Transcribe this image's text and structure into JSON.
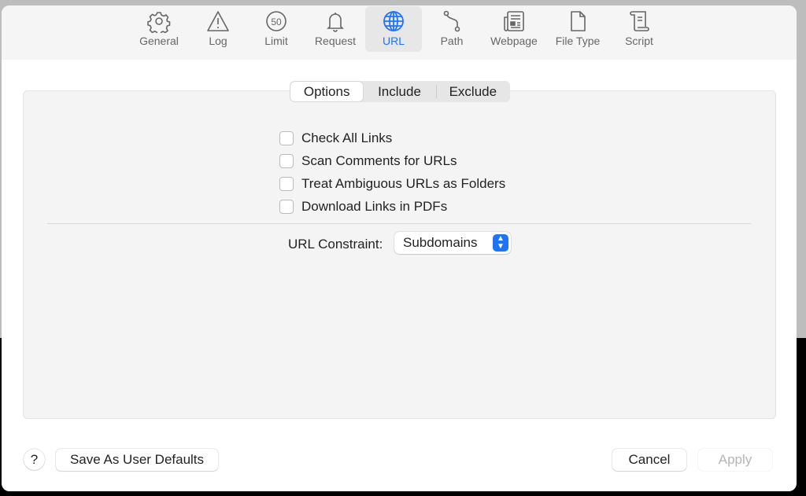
{
  "toolbar": {
    "items": [
      {
        "label": "General",
        "icon": "gear-icon"
      },
      {
        "label": "Log",
        "icon": "warning-icon"
      },
      {
        "label": "Limit",
        "icon": "limit-50-icon",
        "badge": "50"
      },
      {
        "label": "Request",
        "icon": "bell-icon"
      },
      {
        "label": "URL",
        "icon": "globe-icon",
        "active": true
      },
      {
        "label": "Path",
        "icon": "path-icon"
      },
      {
        "label": "Webpage",
        "icon": "newspaper-icon"
      },
      {
        "label": "File Type",
        "icon": "file-icon"
      },
      {
        "label": "Script",
        "icon": "scroll-icon"
      }
    ],
    "accent": "#1f74f5"
  },
  "tabs": {
    "options": "Options",
    "include": "Include",
    "exclude": "Exclude",
    "selected": "Options"
  },
  "options": {
    "checkboxes": [
      {
        "label": "Check All Links",
        "checked": false
      },
      {
        "label": "Scan Comments for URLs",
        "checked": false
      },
      {
        "label": "Treat Ambiguous URLs as Folders",
        "checked": false
      },
      {
        "label": "Download Links in PDFs",
        "checked": false
      }
    ],
    "constraint_label": "URL Constraint:",
    "constraint_value": "Subdomains"
  },
  "footer": {
    "help": "?",
    "save_defaults": "Save As User Defaults",
    "cancel": "Cancel",
    "apply": "Apply"
  }
}
